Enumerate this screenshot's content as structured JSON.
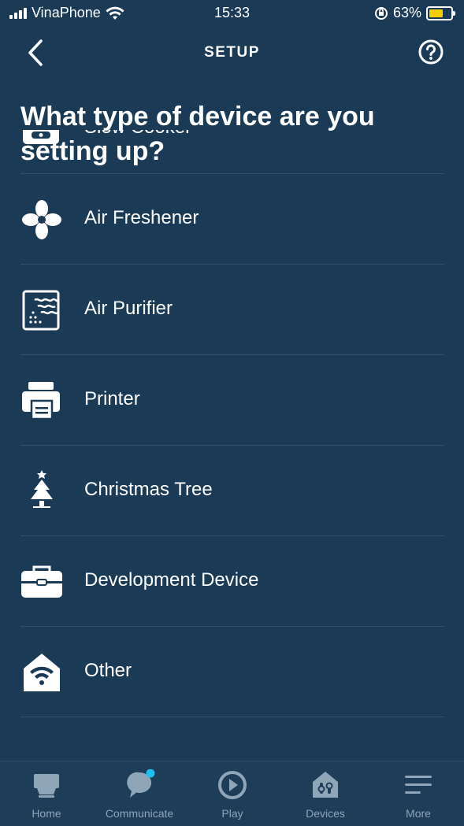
{
  "status_bar": {
    "carrier": "VinaPhone",
    "time": "15:33",
    "battery": "63%"
  },
  "header": {
    "title": "SETUP"
  },
  "heading": "What type of device are you setting up?",
  "device_types": [
    {
      "label": "Slow Cooker",
      "icon": "slow-cooker-icon"
    },
    {
      "label": "Air Freshener",
      "icon": "fan-icon"
    },
    {
      "label": "Air Purifier",
      "icon": "air-purifier-icon"
    },
    {
      "label": "Printer",
      "icon": "printer-icon"
    },
    {
      "label": "Christmas Tree",
      "icon": "christmas-tree-icon"
    },
    {
      "label": "Development Device",
      "icon": "toolbox-icon"
    },
    {
      "label": "Other",
      "icon": "home-wifi-icon"
    }
  ],
  "bottom_nav": [
    {
      "label": "Home",
      "icon": "home-icon"
    },
    {
      "label": "Communicate",
      "icon": "chat-icon"
    },
    {
      "label": "Play",
      "icon": "play-icon"
    },
    {
      "label": "Devices",
      "icon": "devices-icon"
    },
    {
      "label": "More",
      "icon": "menu-icon"
    }
  ],
  "colors": {
    "background": "#1a3a56",
    "divider": "#2e5170",
    "nav_inactive": "#8fa5b8",
    "notification_dot": "#1ec0f0",
    "battery": "#f5d000"
  }
}
